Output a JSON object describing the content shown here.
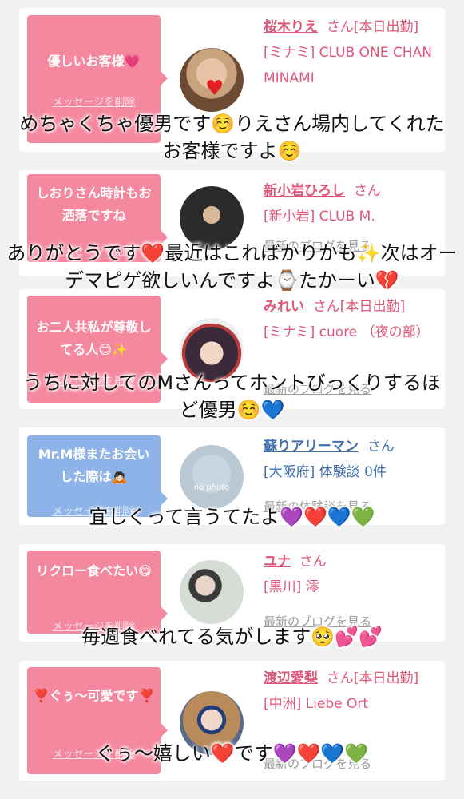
{
  "cards": [
    {
      "bubble": "優しいお客様💗",
      "delete": "メッセージを削除",
      "name": "桜木りえ",
      "suffix": "さん[本日出勤]",
      "shop": "[ミナミ] CLUB ONE CHAN MINAMI",
      "link": "最新のブログを見る"
    },
    {
      "bubble": "しおりさん時計もお洒落ですね",
      "delete": "メッセージを削除",
      "name": "新小岩ひろし",
      "suffix": "さん",
      "shop": "[新小岩] CLUB M.",
      "link": "最新のブログを見る"
    },
    {
      "bubble": "お二人共私が尊敬してる人😊✨",
      "delete": "メッセージを削除",
      "name": "みれい",
      "suffix": "さん[本日出勤]",
      "shop": "[ミナミ] cuore （夜の部）",
      "link": "最新のブログを見る"
    },
    {
      "bubble": "Mr.M様またお会いした際は🙇🏻",
      "delete": "メッセージを削除",
      "name": "蘇りアリーマン",
      "suffix": "さん",
      "shop": "[大阪府] 体験談 0件",
      "link": "最新の体験談を見る",
      "avatar_text": "no photo"
    },
    {
      "bubble": "リクロー食べたい😋",
      "delete": "メッセージを削除",
      "name": "ユナ",
      "suffix": "さん",
      "shop": "[黒川] 澪",
      "link": "最新のブログを見る"
    },
    {
      "bubble": "❣️ぐぅ〜可愛です❣️",
      "delete": "メッセージを削除",
      "name": "渡辺愛梨",
      "suffix": "さん[本日出勤]",
      "shop": "[中洲] Liebe Ort",
      "link": "最新のブログを見る"
    }
  ],
  "captions": [
    "めちゃくちゃ優男です☺️りえさん場内してくれたお客様ですよ☺️",
    "ありがとうです❤️最近はこればかりかも✨次はオーデマピゲ欲しいんですよ⌚️たかーい💔",
    "うちに対してのMさんってホントびっくりするほど優男☺️💙",
    "宜しくって言うてたよ💜❤️💙💚",
    "毎週食べれてる気がします🥺💕💕",
    "ぐぅ〜嬉しい❤️です💜❤️💙💚"
  ],
  "colors": {
    "pink_bubble": "#f4889e",
    "blue_bubble": "#8db3e8",
    "name_pink": "#e0567a",
    "name_blue": "#3f6fb0",
    "background": "#f1f1f2"
  }
}
